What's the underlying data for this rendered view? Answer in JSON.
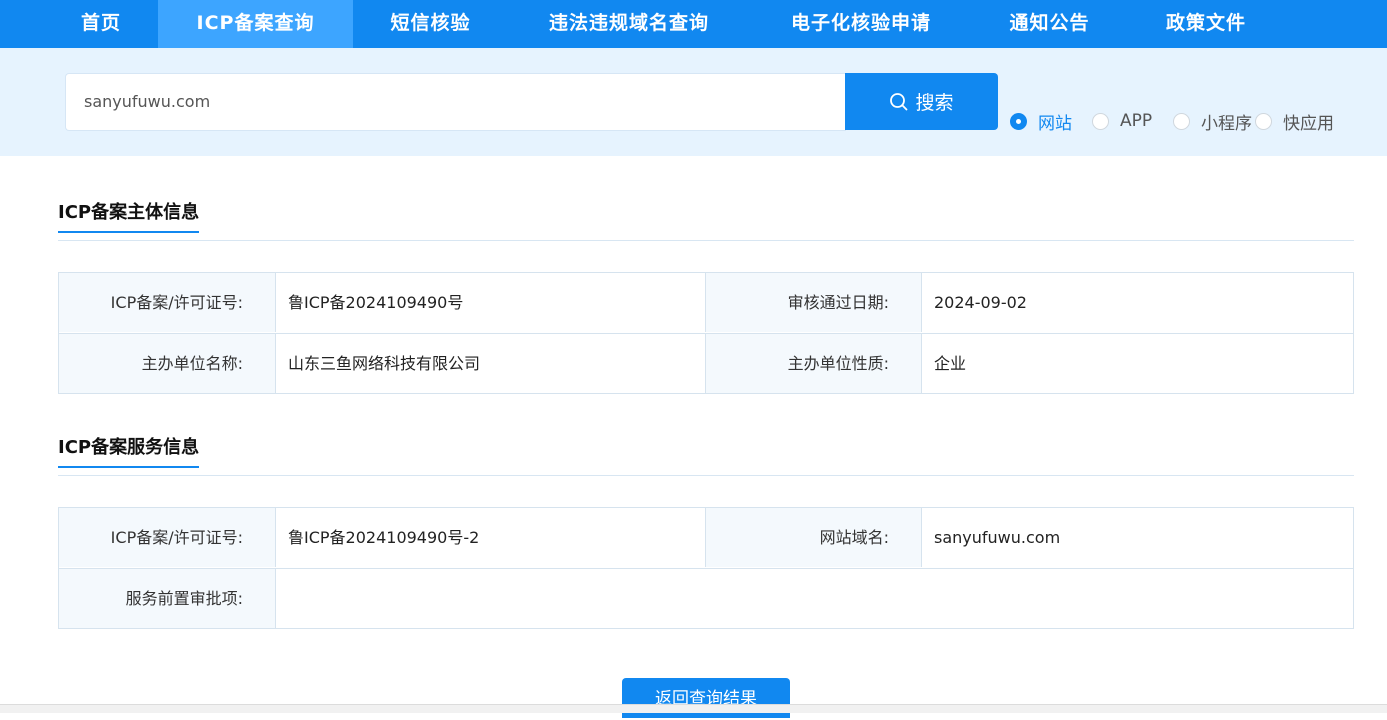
{
  "nav": {
    "items": [
      {
        "label": "首页"
      },
      {
        "label": "ICP备案查询"
      },
      {
        "label": "短信核验"
      },
      {
        "label": "违法违规域名查询"
      },
      {
        "label": "电子化核验申请"
      },
      {
        "label": "通知公告"
      },
      {
        "label": "政策文件"
      }
    ],
    "active": "ICP备案查询"
  },
  "search": {
    "value": "sanyufuwu.com",
    "button_label": "搜索",
    "options": [
      {
        "label": "网站",
        "checked": true
      },
      {
        "label": "APP",
        "checked": false
      },
      {
        "label": "小程序",
        "checked": false
      },
      {
        "label": "快应用",
        "checked": false
      }
    ]
  },
  "subject": {
    "title": "ICP备案主体信息",
    "rows": [
      {
        "label1": "ICP备案/许可证号:",
        "value1": "鲁ICP备2024109490号",
        "label2": "审核通过日期:",
        "value2": "2024-09-02"
      },
      {
        "label1": "主办单位名称:",
        "value1": "山东三鱼网络科技有限公司",
        "label2": "主办单位性质:",
        "value2": "企业"
      }
    ]
  },
  "service": {
    "title": "ICP备案服务信息",
    "rows": [
      {
        "label1": "ICP备案/许可证号:",
        "value1": "鲁ICP备2024109490号-2",
        "label2": "网站域名:",
        "value2": "sanyufuwu.com"
      }
    ],
    "approval": {
      "label": "服务前置审批项:",
      "value": ""
    }
  },
  "back_button": "返回查询结果",
  "colors": {
    "primary": "#1188f0",
    "active_tab": "#3da5ff",
    "band": "#e6f3fe"
  }
}
